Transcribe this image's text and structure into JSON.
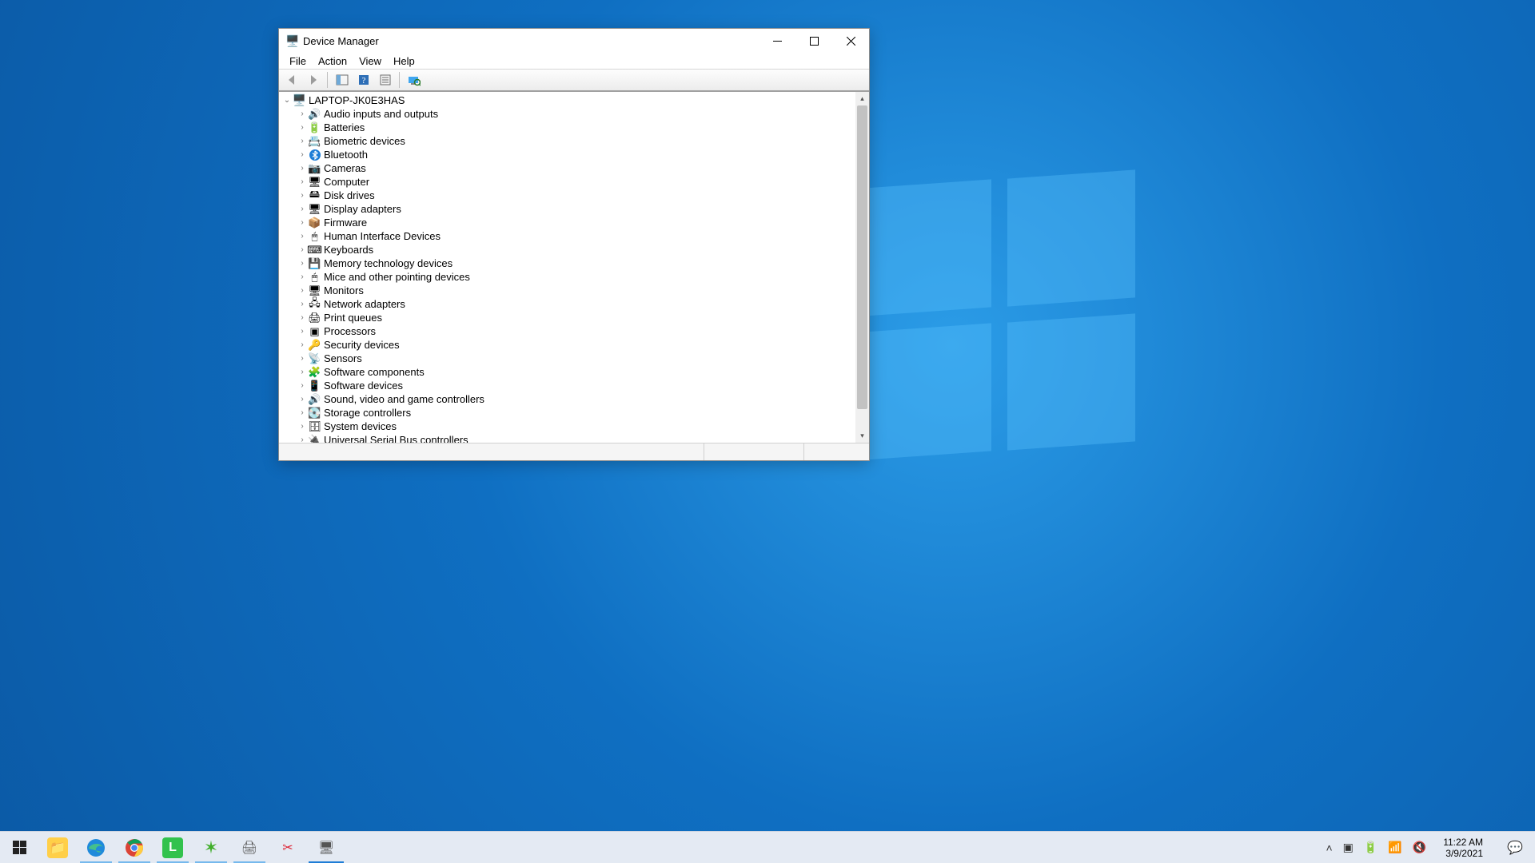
{
  "window": {
    "title": "Device Manager"
  },
  "menu": {
    "file": "File",
    "action": "Action",
    "view": "View",
    "help": "Help"
  },
  "tree": {
    "root_label": "LAPTOP-JK0E3HAS",
    "items": [
      {
        "label": "Audio inputs and outputs",
        "glyph": "🔊"
      },
      {
        "label": "Batteries",
        "glyph": "🔋"
      },
      {
        "label": "Biometric devices",
        "glyph": "📇"
      },
      {
        "label": "Bluetooth",
        "glyph": ""
      },
      {
        "label": "Cameras",
        "glyph": "📷"
      },
      {
        "label": "Computer",
        "glyph": "🖥"
      },
      {
        "label": "Disk drives",
        "glyph": "🖴"
      },
      {
        "label": "Display adapters",
        "glyph": "🖥"
      },
      {
        "label": "Firmware",
        "glyph": "📦"
      },
      {
        "label": "Human Interface Devices",
        "glyph": "🖱"
      },
      {
        "label": "Keyboards",
        "glyph": "⌨"
      },
      {
        "label": "Memory technology devices",
        "glyph": "💾"
      },
      {
        "label": "Mice and other pointing devices",
        "glyph": "🖱"
      },
      {
        "label": "Monitors",
        "glyph": "🖥"
      },
      {
        "label": "Network adapters",
        "glyph": "🖧"
      },
      {
        "label": "Print queues",
        "glyph": "🖨"
      },
      {
        "label": "Processors",
        "glyph": "▣"
      },
      {
        "label": "Security devices",
        "glyph": "🔑"
      },
      {
        "label": "Sensors",
        "glyph": "📡"
      },
      {
        "label": "Software components",
        "glyph": "🧩"
      },
      {
        "label": "Software devices",
        "glyph": "📱"
      },
      {
        "label": "Sound, video and game controllers",
        "glyph": "🔊"
      },
      {
        "label": "Storage controllers",
        "glyph": "💽"
      },
      {
        "label": "System devices",
        "glyph": "🗄"
      },
      {
        "label": "Universal Serial Bus controllers",
        "glyph": "🔌"
      }
    ]
  },
  "taskbar": {
    "time": "11:22 AM",
    "date": "3/9/2021"
  }
}
